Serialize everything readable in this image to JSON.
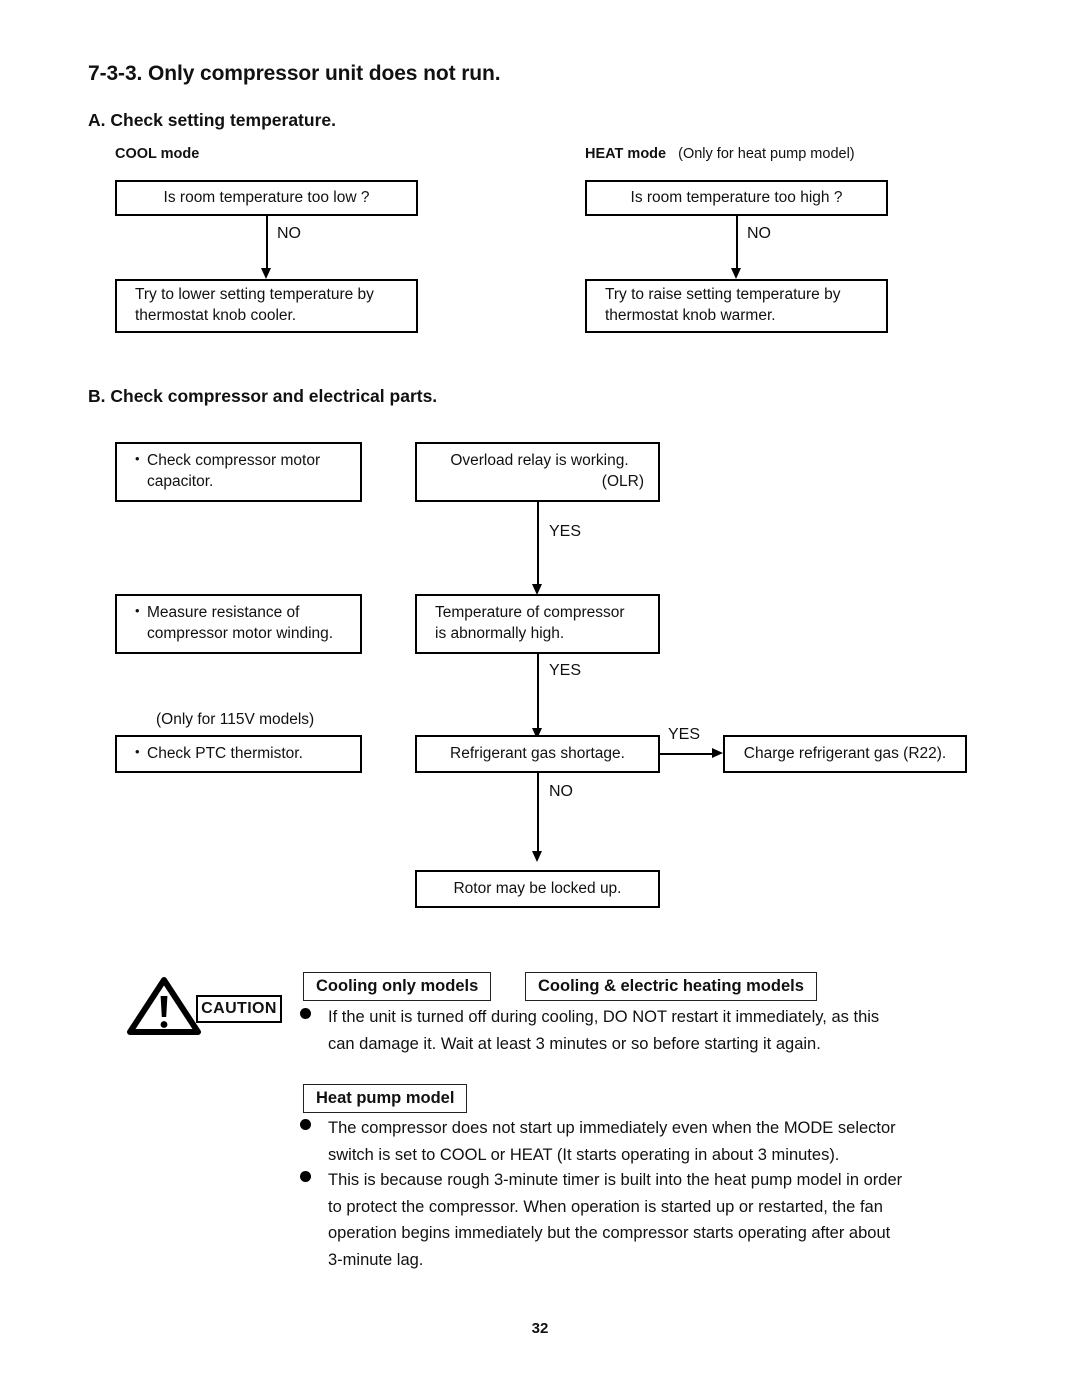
{
  "document": {
    "section_title": "7-3-3. Only compressor unit does not run.",
    "page_number": "32"
  },
  "section_a": {
    "heading": "A. Check setting temperature.",
    "cool": {
      "mode_label": "COOL mode",
      "question": "Is room temperature too low ?",
      "branch_label": "NO",
      "action_line1": "Try to lower setting temperature by",
      "action_line2": "thermostat knob cooler."
    },
    "heat": {
      "mode_label": "HEAT mode",
      "mode_note": "(Only for heat pump model)",
      "question": "Is room temperature too high ?",
      "branch_label": "NO",
      "action_line1": "Try to raise setting temperature by",
      "action_line2": "thermostat knob warmer."
    }
  },
  "section_b": {
    "heading": "B. Check compressor and electrical parts.",
    "checks": [
      {
        "line1": "Check compressor motor",
        "line2": "capacitor."
      },
      {
        "line1": "Measure resistance of",
        "line2": "compressor motor winding."
      },
      {
        "note": "(Only for 115V models)",
        "line1": "Check PTC thermistor."
      }
    ],
    "flow": {
      "olr_line1": "Overload relay is working.",
      "olr_line2": "(OLR)",
      "yes_1": "YES",
      "temp_line1": "Temperature of compressor",
      "temp_line2": "is abnormally high.",
      "yes_2": "YES",
      "gas_shortage": "Refrigerant gas shortage.",
      "yes_3": "YES",
      "charge_gas": "Charge refrigerant gas (R22).",
      "no_1": "NO",
      "rotor": "Rotor may be locked up."
    }
  },
  "caution": {
    "label": "CAUTION",
    "icon": "warning-triangle-icon",
    "tags": {
      "cooling_only": "Cooling only models",
      "cooling_electric": "Cooling & electric heating models",
      "heat_pump": "Heat pump model"
    },
    "notes_cooling": [
      {
        "line1": "If the unit is turned off during cooling, DO NOT restart it immediately, as this",
        "line2": "can damage it. Wait at least 3 minutes or so before starting it again."
      }
    ],
    "notes_heat_pump": [
      {
        "line1": "The compressor does not start up immediately even when the MODE selector",
        "line2": "switch is set to COOL or HEAT (It starts operating in about 3 minutes)."
      },
      {
        "line1": "This is because rough 3-minute timer is built into the heat pump model in order",
        "line2": "to protect the compressor. When operation is started up or restarted, the fan",
        "line3": "operation begins immediately but the compressor starts operating after about",
        "line4": "3-minute lag."
      }
    ]
  }
}
